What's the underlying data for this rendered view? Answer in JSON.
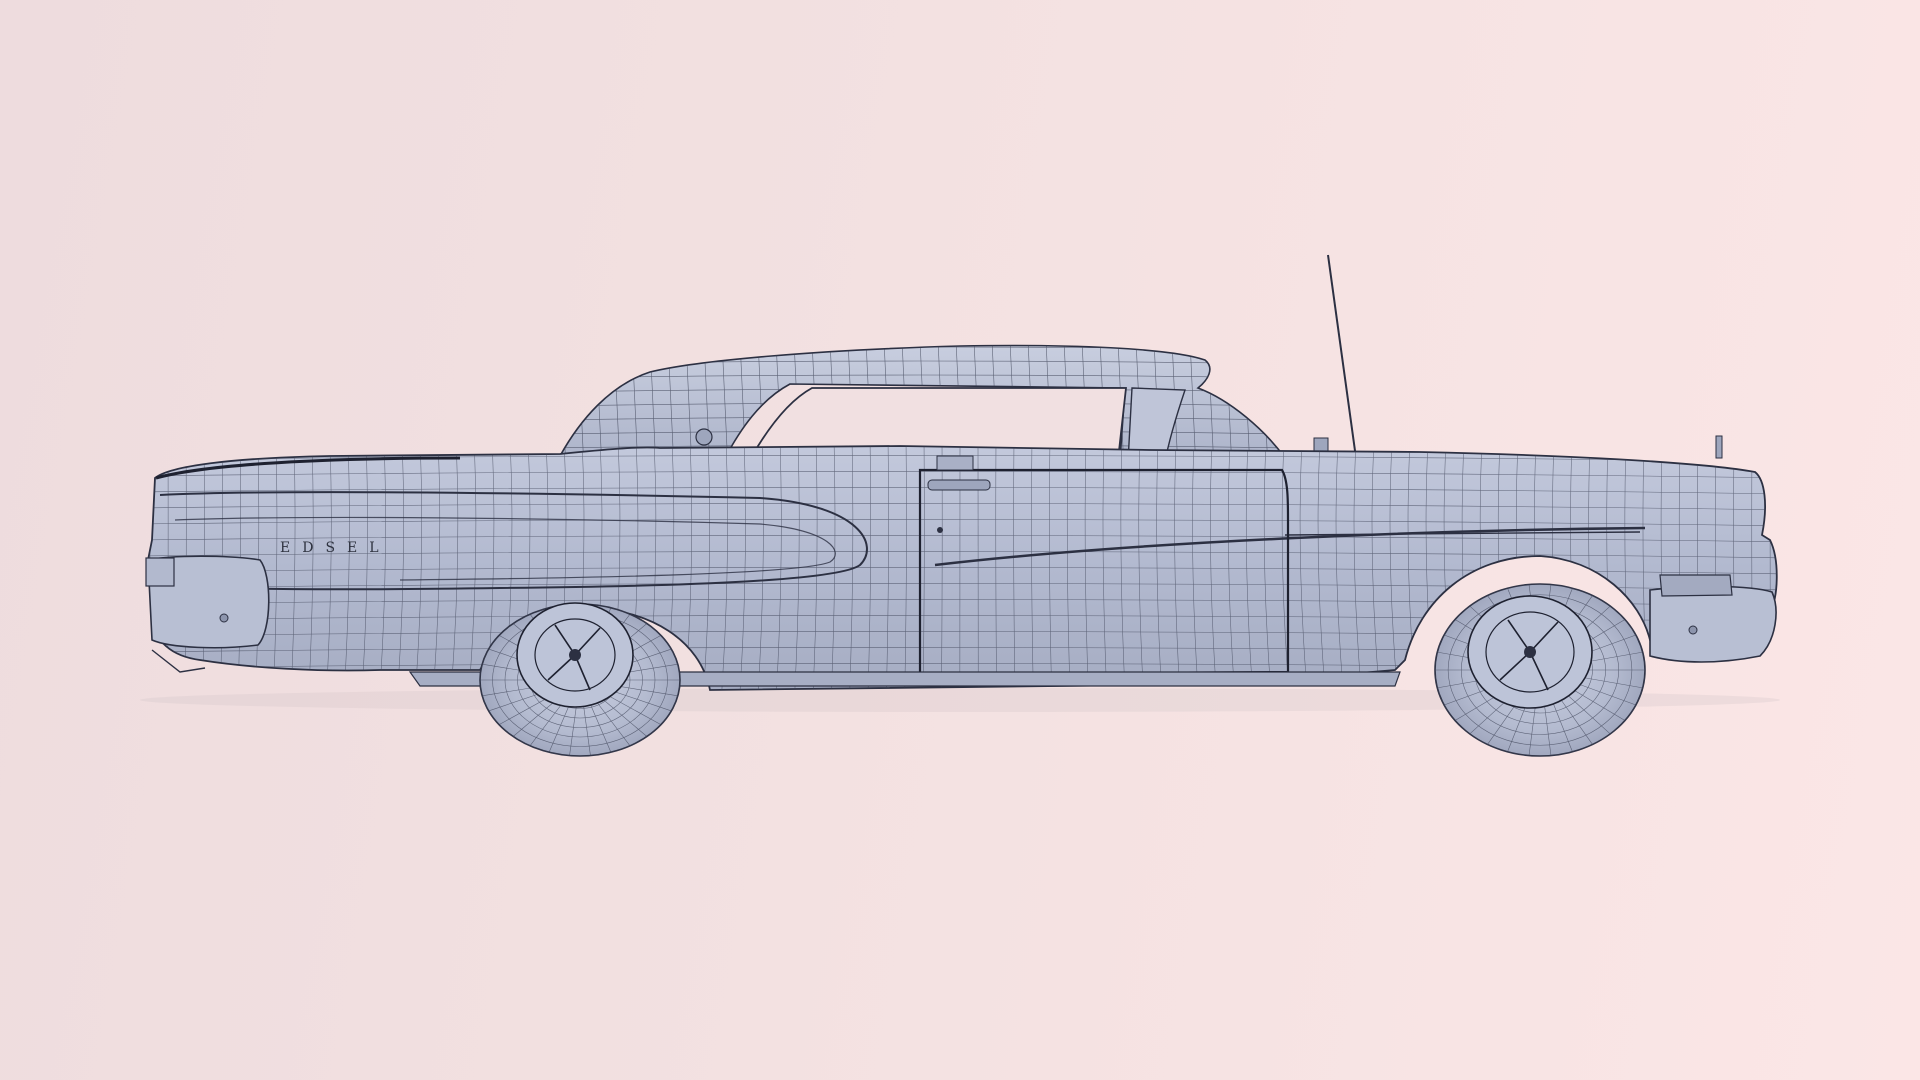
{
  "scene": {
    "subject": "wireframe-car-side-view",
    "background_colors": [
      "#eedcde",
      "#fbe6e6"
    ],
    "body_color": "#b6bdd3",
    "wire_color": "#2c3042",
    "badge_text": "EDSEL"
  }
}
